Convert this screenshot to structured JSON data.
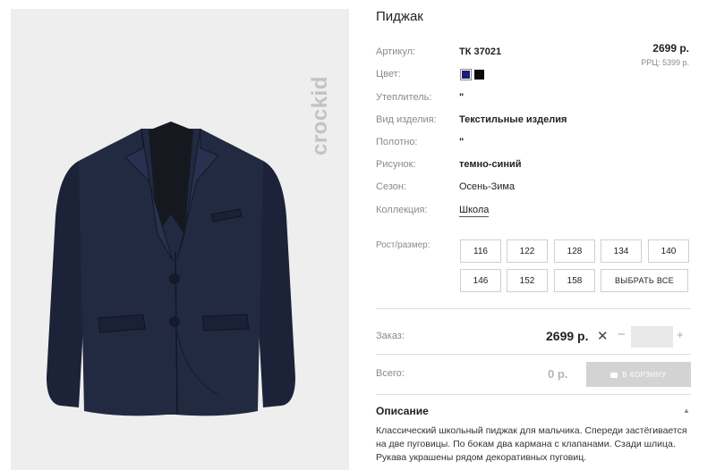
{
  "product": {
    "title": "Пиджак",
    "brand": "crockid",
    "price": "2699 р.",
    "rrp": "РРЦ: 5399 р."
  },
  "attributes": [
    {
      "label": "Артикул:",
      "value": "ТК 37021"
    },
    {
      "label": "Цвет:",
      "value": ""
    },
    {
      "label": "Утеплитель:",
      "value": "\""
    },
    {
      "label": "Вид изделия:",
      "value": "Текстильные изделия"
    },
    {
      "label": "Полотно:",
      "value": "\""
    },
    {
      "label": "Рисунок:",
      "value": "темно-синий"
    },
    {
      "label": "Сезон:",
      "value": "Осень-Зима"
    },
    {
      "label": "Коллекция:",
      "value": "Школа"
    }
  ],
  "colors": [
    "#1b1f6e",
    "#0a0a0a"
  ],
  "sizes": {
    "label": "Рост/размер:",
    "options": [
      "116",
      "122",
      "128",
      "134",
      "140",
      "146",
      "152",
      "158"
    ],
    "select_all": "ВЫБРАТЬ ВСЕ"
  },
  "order": {
    "label": "Заказ:",
    "price": "2699 р.",
    "times": "✕",
    "minus": "−",
    "plus": "+",
    "quantity": ""
  },
  "total": {
    "label": "Всего:",
    "value": "0 р.",
    "cart_button": "В КОРЗИНУ"
  },
  "description": {
    "title": "Описание",
    "text": "Классический школьный пиджак для мальчика. Спереди застёгивается на две пуговицы. По бокам два кармана с клапанами. Сзади шлица. Рукава украшены рядом декоративных пуговиц."
  }
}
